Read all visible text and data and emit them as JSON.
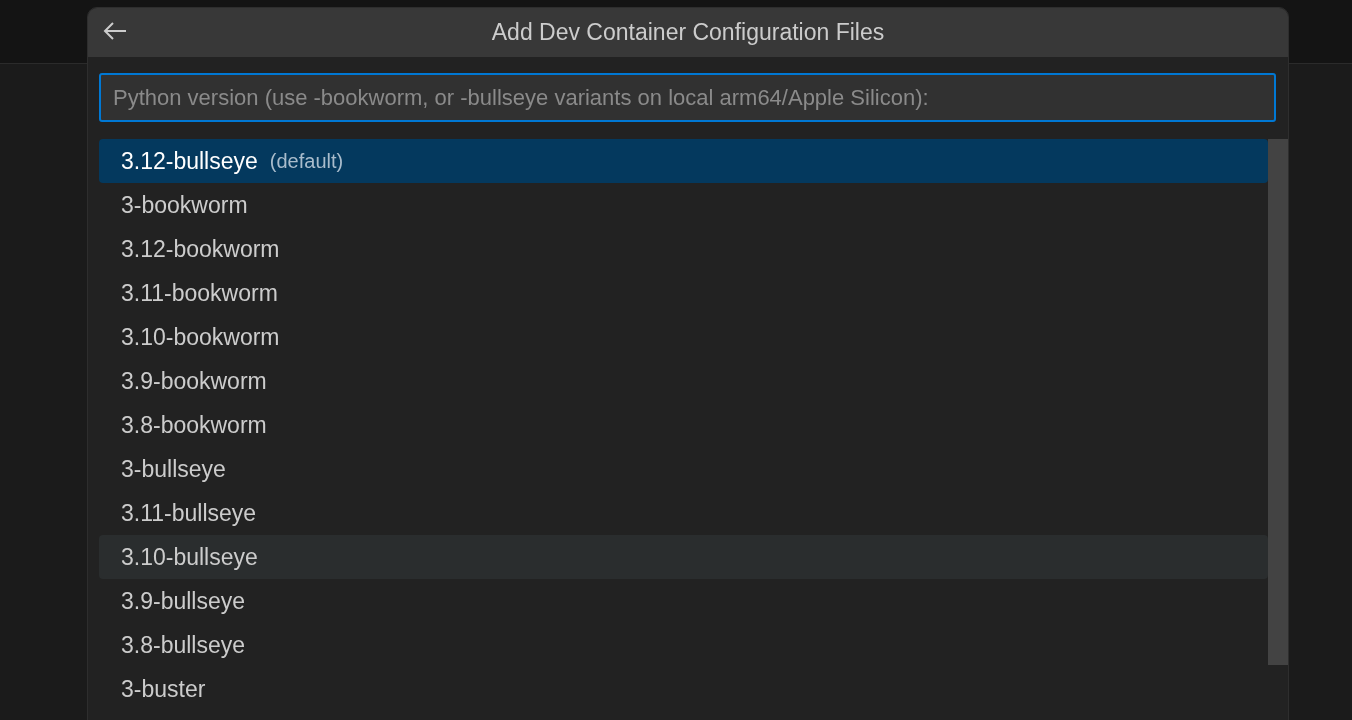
{
  "dialog": {
    "title": "Add Dev Container Configuration Files",
    "search": {
      "placeholder": "Python version (use -bookworm, or -bullseye variants on local arm64/Apple Silicon):"
    },
    "items": [
      {
        "label": "3.12-bullseye",
        "description": "(default)",
        "selected": true,
        "hovered": false
      },
      {
        "label": "3-bookworm",
        "selected": false,
        "hovered": false
      },
      {
        "label": "3.12-bookworm",
        "selected": false,
        "hovered": false
      },
      {
        "label": "3.11-bookworm",
        "selected": false,
        "hovered": false
      },
      {
        "label": "3.10-bookworm",
        "selected": false,
        "hovered": false
      },
      {
        "label": "3.9-bookworm",
        "selected": false,
        "hovered": false
      },
      {
        "label": "3.8-bookworm",
        "selected": false,
        "hovered": false
      },
      {
        "label": "3-bullseye",
        "selected": false,
        "hovered": false
      },
      {
        "label": "3.11-bullseye",
        "selected": false,
        "hovered": false
      },
      {
        "label": "3.10-bullseye",
        "selected": false,
        "hovered": true
      },
      {
        "label": "3.9-bullseye",
        "selected": false,
        "hovered": false
      },
      {
        "label": "3.8-bullseye",
        "selected": false,
        "hovered": false
      },
      {
        "label": "3-buster",
        "selected": false,
        "hovered": false
      }
    ]
  }
}
